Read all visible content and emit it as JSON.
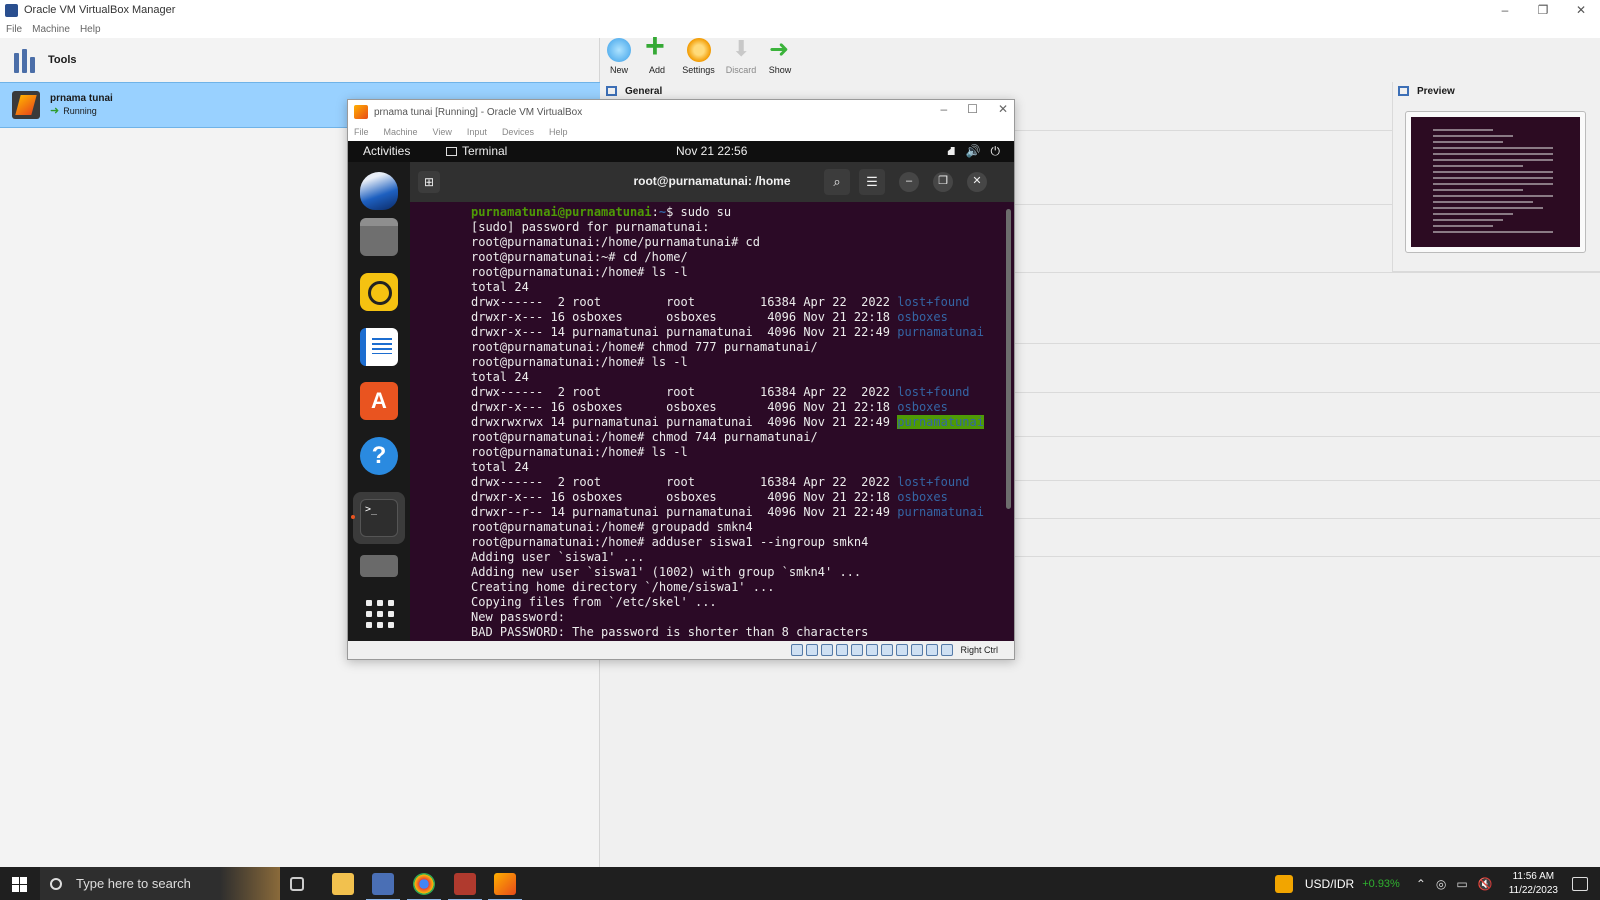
{
  "manager": {
    "title": "Oracle VM VirtualBox Manager",
    "menu": [
      "File",
      "Machine",
      "Help"
    ],
    "tools_label": "Tools",
    "vm": {
      "name": "prnama tunai",
      "status": "Running"
    },
    "toolbar": {
      "new": "New",
      "add": "Add",
      "settings": "Settings",
      "discard": "Discard",
      "show": "Show"
    },
    "general_label": "General",
    "preview_label": "Preview"
  },
  "vm_window": {
    "title": "prnama tunai [Running] - Oracle VM VirtualBox",
    "menu": [
      "File",
      "Machine",
      "View",
      "Input",
      "Devices",
      "Help"
    ],
    "host_key": "Right Ctrl"
  },
  "guest": {
    "activities": "Activities",
    "app_name": "Terminal",
    "clock": "Nov 21  22:56",
    "terminal_title": "root@purnamatunai: /home"
  },
  "terminal": {
    "lines": [
      {
        "user": "purnamatunai@purnamatunai",
        "sep": ":",
        "path": "~",
        "cmd": "$ sudo su"
      },
      {
        "text": "[sudo] password for purnamatunai:"
      },
      {
        "text": "root@purnamatunai:/home/purnamatunai# cd"
      },
      {
        "text": "root@purnamatunai:~# cd /home/"
      },
      {
        "text": "root@purnamatunai:/home# ls -l"
      },
      {
        "text": "total 24"
      },
      {
        "text": "drwx------  2 root         root         16384 Apr 22  2022 ",
        "dir": "lost+found"
      },
      {
        "text": "drwxr-x--- 16 osboxes      osboxes       4096 Nov 21 22:18 ",
        "dir": "osboxes"
      },
      {
        "text": "drwxr-x--- 14 purnamatunai purnamatunai  4096 Nov 21 22:49 ",
        "dir": "purnamatunai"
      },
      {
        "text": "root@purnamatunai:/home# chmod 777 purnamatunai/"
      },
      {
        "text": "root@purnamatunai:/home# ls -l"
      },
      {
        "text": "total 24"
      },
      {
        "text": "drwx------  2 root         root         16384 Apr 22  2022 ",
        "dir": "lost+found"
      },
      {
        "text": "drwxr-x--- 16 osboxes      osboxes       4096 Nov 21 22:18 ",
        "dir": "osboxes"
      },
      {
        "text": "drwxrwxrwx 14 purnamatunai purnamatunai  4096 Nov 21 22:49 ",
        "dir": "purnamatunai",
        "highlight": true
      },
      {
        "text": "root@purnamatunai:/home# chmod 744 purnamatunai/"
      },
      {
        "text": "root@purnamatunai:/home# ls -l"
      },
      {
        "text": "total 24"
      },
      {
        "text": "drwx------  2 root         root         16384 Apr 22  2022 ",
        "dir": "lost+found"
      },
      {
        "text": "drwxr-x--- 16 osboxes      osboxes       4096 Nov 21 22:18 ",
        "dir": "osboxes"
      },
      {
        "text": "drwxr--r-- 14 purnamatunai purnamatunai  4096 Nov 21 22:49 ",
        "dir": "purnamatunai"
      },
      {
        "text": "root@purnamatunai:/home# groupadd smkn4"
      },
      {
        "text": "root@purnamatunai:/home# adduser siswa1 --ingroup smkn4"
      },
      {
        "text": "Adding user `siswa1' ..."
      },
      {
        "text": "Adding new user `siswa1' (1002) with group `smkn4' ..."
      },
      {
        "text": "Creating home directory `/home/siswa1' ..."
      },
      {
        "text": "Copying files from `/etc/skel' ..."
      },
      {
        "text": "New password:"
      },
      {
        "text": "BAD PASSWORD: The password is shorter than 8 characters"
      }
    ]
  },
  "taskbar": {
    "search_placeholder": "Type here to search",
    "currency": "USD/IDR",
    "currency_change": "+0.93%",
    "time": "11:56 AM",
    "date": "11/22/2023"
  },
  "colors": {
    "terminal_bg": "#2b0a26",
    "prompt_green": "#4e9a06",
    "dir_blue": "#3465a4",
    "selection_blue": "#99d1ff"
  }
}
